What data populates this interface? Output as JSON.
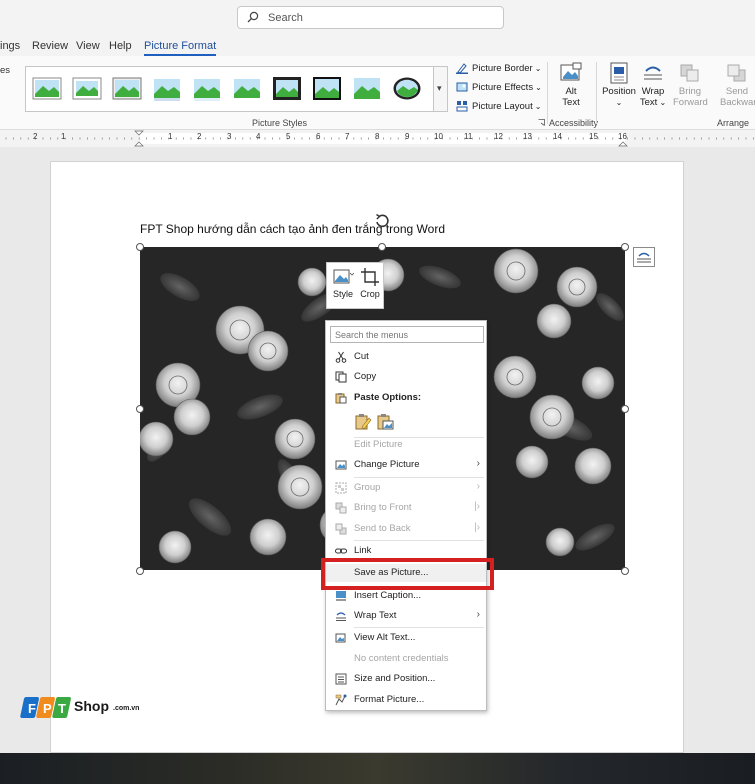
{
  "search": {
    "label": "Search"
  },
  "tabs": [
    "ings",
    "Review",
    "View",
    "Help",
    "Picture Format"
  ],
  "ribbon": {
    "left_cut": "es",
    "styles_group_label": "Picture Styles",
    "picture_border": "Picture Border",
    "picture_effects": "Picture Effects",
    "picture_layout": "Picture Layout",
    "alt_text_line1": "Alt",
    "alt_text_line2": "Text",
    "accessibility_label": "Accessibility",
    "position": "Position",
    "wrap_text_line1": "Wrap",
    "wrap_text_line2": "Text",
    "bring_forward_line1": "Bring",
    "bring_forward_line2": "Forward",
    "send_backward_line1": "Send",
    "send_backward_line2": "Backward",
    "arrange_label": "Arrange"
  },
  "ruler": {
    "numbers": [
      "1",
      "2",
      "1",
      "2",
      "3",
      "4",
      "5",
      "6",
      "7",
      "8",
      "9",
      "10",
      "11",
      "12",
      "13",
      "14",
      "15",
      "16"
    ]
  },
  "document": {
    "heading": "FPT Shop hướng dẫn cách tạo ảnh đen trắng trong Word"
  },
  "mini_toolbar": {
    "style": "Style",
    "crop": "Crop"
  },
  "context_menu": {
    "search_placeholder": "Search the menus",
    "items": [
      {
        "label": "Cut",
        "icon": "scissors-icon"
      },
      {
        "label": "Copy",
        "icon": "copy-icon"
      },
      {
        "label": "Paste Options:",
        "icon": "paste-icon"
      },
      {
        "label": "Edit Picture",
        "icon": ""
      },
      {
        "label": "Change Picture",
        "icon": "change-picture-icon"
      },
      {
        "label": "Group",
        "icon": "group-icon"
      },
      {
        "label": "Bring to Front",
        "icon": "bring-front-icon"
      },
      {
        "label": "Send to Back",
        "icon": "send-back-icon"
      },
      {
        "label": "Link",
        "icon": "link-icon"
      },
      {
        "label": "Save as Picture...",
        "icon": ""
      },
      {
        "label": "Insert Caption...",
        "icon": "caption-icon"
      },
      {
        "label": "Wrap Text",
        "icon": "wrap-text-icon"
      },
      {
        "label": "View Alt Text...",
        "icon": "alt-text-icon"
      },
      {
        "label": "No content credentials",
        "icon": ""
      },
      {
        "label": "Size and Position...",
        "icon": "size-position-icon"
      },
      {
        "label": "Format Picture...",
        "icon": "format-picture-icon"
      }
    ]
  },
  "logo": {
    "brand": "Shop",
    "domain": ".com.vn",
    "letters": "FPT"
  },
  "colors": {
    "accent": "#1f5fbf",
    "highlight_box": "#d42020"
  }
}
